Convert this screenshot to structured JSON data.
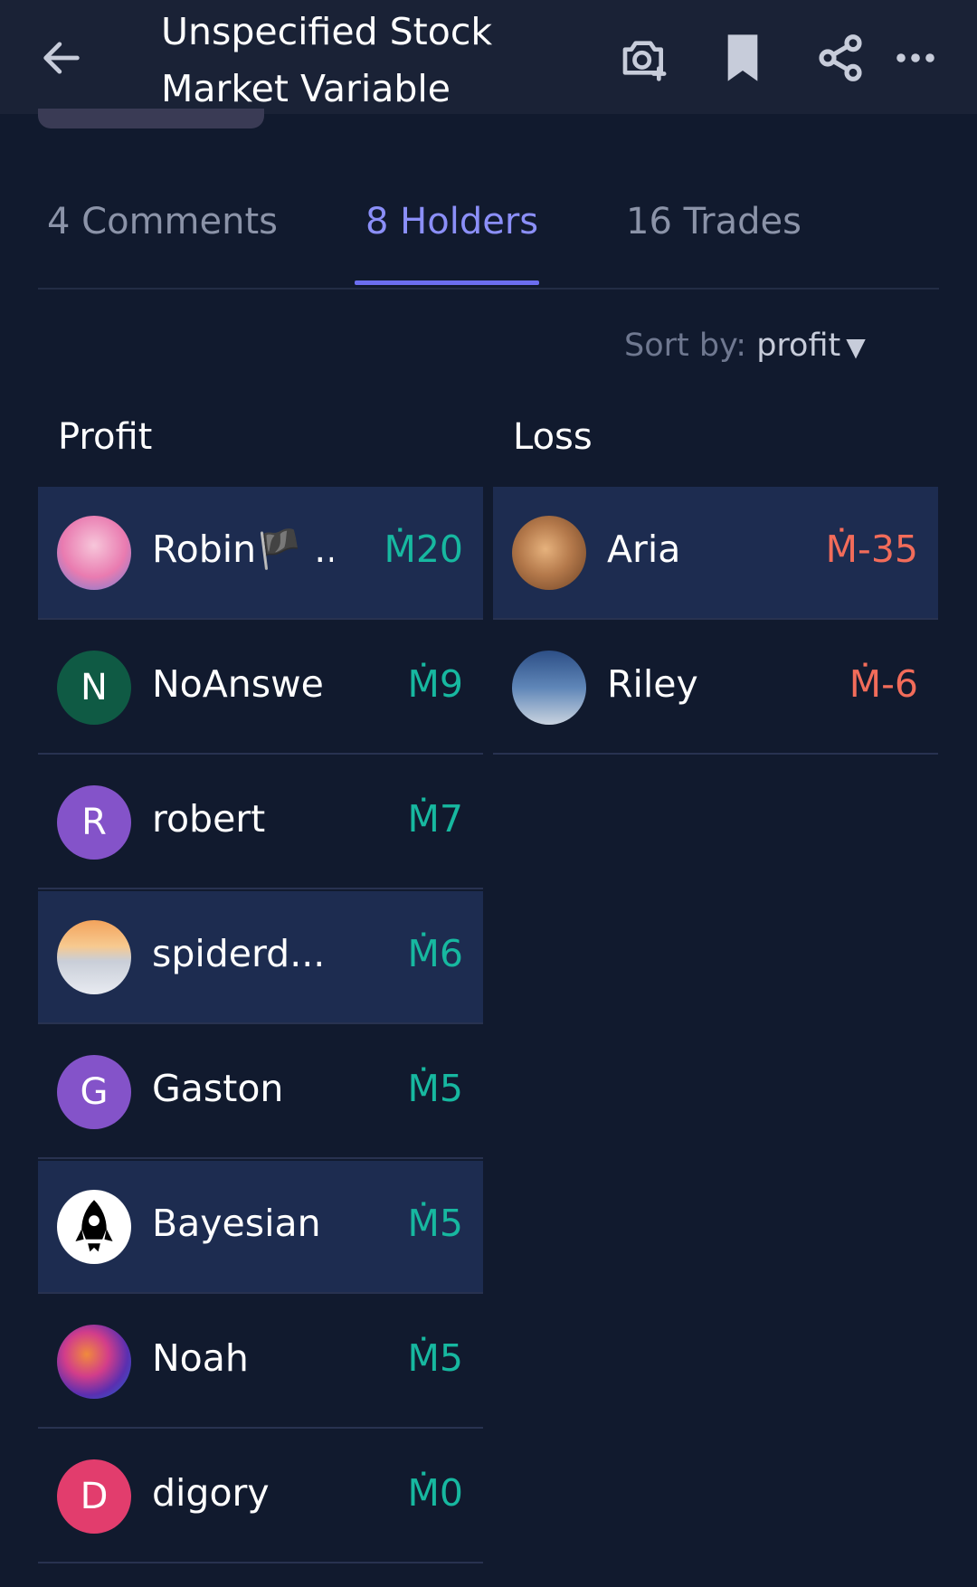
{
  "header": {
    "title": "Unspecified Stock Market Variable",
    "icons": [
      "back-arrow-icon",
      "camera-plus-icon",
      "bookmark-icon",
      "share-icon",
      "more-icon"
    ]
  },
  "tabs": [
    {
      "label": "4 Comments"
    },
    {
      "label": "8 Holders"
    },
    {
      "label": "16 Trades"
    }
  ],
  "sort": {
    "prefix": "Sort by:",
    "value": "profit",
    "caret": "▼"
  },
  "columns": {
    "profit": "Profit",
    "loss": "Loss"
  },
  "profit_holders": [
    {
      "name": "Robin🏴 ...",
      "amount": "Ṁ20",
      "avatar_letter": "",
      "avatar_color": "#f2a6c8"
    },
    {
      "name": "NoAnswer",
      "amount": "Ṁ9",
      "avatar_letter": "N",
      "avatar_color": "#0f5a44"
    },
    {
      "name": "robert",
      "amount": "Ṁ7",
      "avatar_letter": "R",
      "avatar_color": "#8453c9"
    },
    {
      "name": "spiderd...",
      "amount": "Ṁ6",
      "avatar_letter": "",
      "avatar_color": "#d9dde6"
    },
    {
      "name": "Gaston",
      "amount": "Ṁ5",
      "avatar_letter": "G",
      "avatar_color": "#8453c9"
    },
    {
      "name": "Bayesian ",
      "amount": "Ṁ5",
      "avatar_letter": "",
      "avatar_color": "#ffffff"
    },
    {
      "name": "Noah",
      "amount": "Ṁ5",
      "avatar_letter": "",
      "avatar_color": "#5a2fb0"
    },
    {
      "name": "digory",
      "amount": "Ṁ0",
      "avatar_letter": "D",
      "avatar_color": "#e23d6d"
    }
  ],
  "loss_holders": [
    {
      "name": "Aria",
      "amount": "Ṁ-35",
      "avatar_letter": "",
      "avatar_color": "#b4794b"
    },
    {
      "name": "Riley",
      "amount": "Ṁ-6",
      "avatar_letter": "",
      "avatar_color": "#5f86b8"
    }
  ],
  "colors": {
    "background": "#111a2e",
    "highlight_row": "#1d2c50",
    "accent": "#6c6ef0",
    "profit": "#17b8a0",
    "loss": "#f26c5a"
  }
}
